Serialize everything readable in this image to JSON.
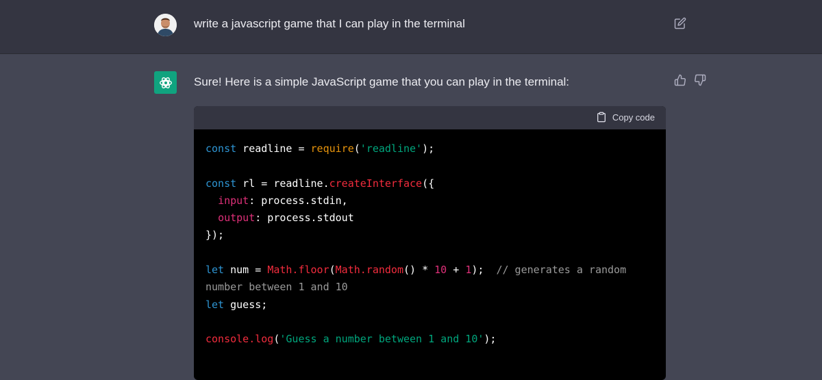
{
  "user_message": {
    "text": "write a javascript game that I can play in the terminal"
  },
  "assistant_message": {
    "intro": "Sure! Here is a simple JavaScript game that you can play in the terminal:"
  },
  "code_block": {
    "copy_label": "Copy code",
    "tokens": {
      "const": "const",
      "let": "let",
      "readline_var": " readline = ",
      "require_fn": "require",
      "readline_str": "'readline'",
      "end_paren_semi": ");",
      "rl_assign": " rl = readline.",
      "create_fn": "createInterface",
      "open_obj": "({",
      "input_key": "input",
      "input_val": ": process.stdin,",
      "output_key": "output",
      "output_val": ": process.stdout",
      "close_obj": "});",
      "num_assign": " num = ",
      "math_floor": "Math.floor",
      "paren_open": "(",
      "math_random": "Math.random",
      "random_tail": "() * ",
      "ten": "10",
      "plus": " + ",
      "one": "1",
      "close_semi": ");  ",
      "comment1": "// generates a random",
      "comment2": "number between 1 and 10",
      "guess_decl": " guess;",
      "console_log": "console.log",
      "guess_str": "'Guess a number between 1 and 10'"
    }
  },
  "colors": {
    "page_bg": "#444654",
    "user_row_bg": "#343541",
    "assistant_avatar_bg": "#10a37f",
    "code_bg": "#000000"
  },
  "icons": {
    "edit": "pencil-square-icon",
    "copy": "clipboard-icon",
    "thumb_up": "thumbs-up-icon",
    "thumb_down": "thumbs-down-icon",
    "assistant_logo": "openai-logo-icon"
  }
}
